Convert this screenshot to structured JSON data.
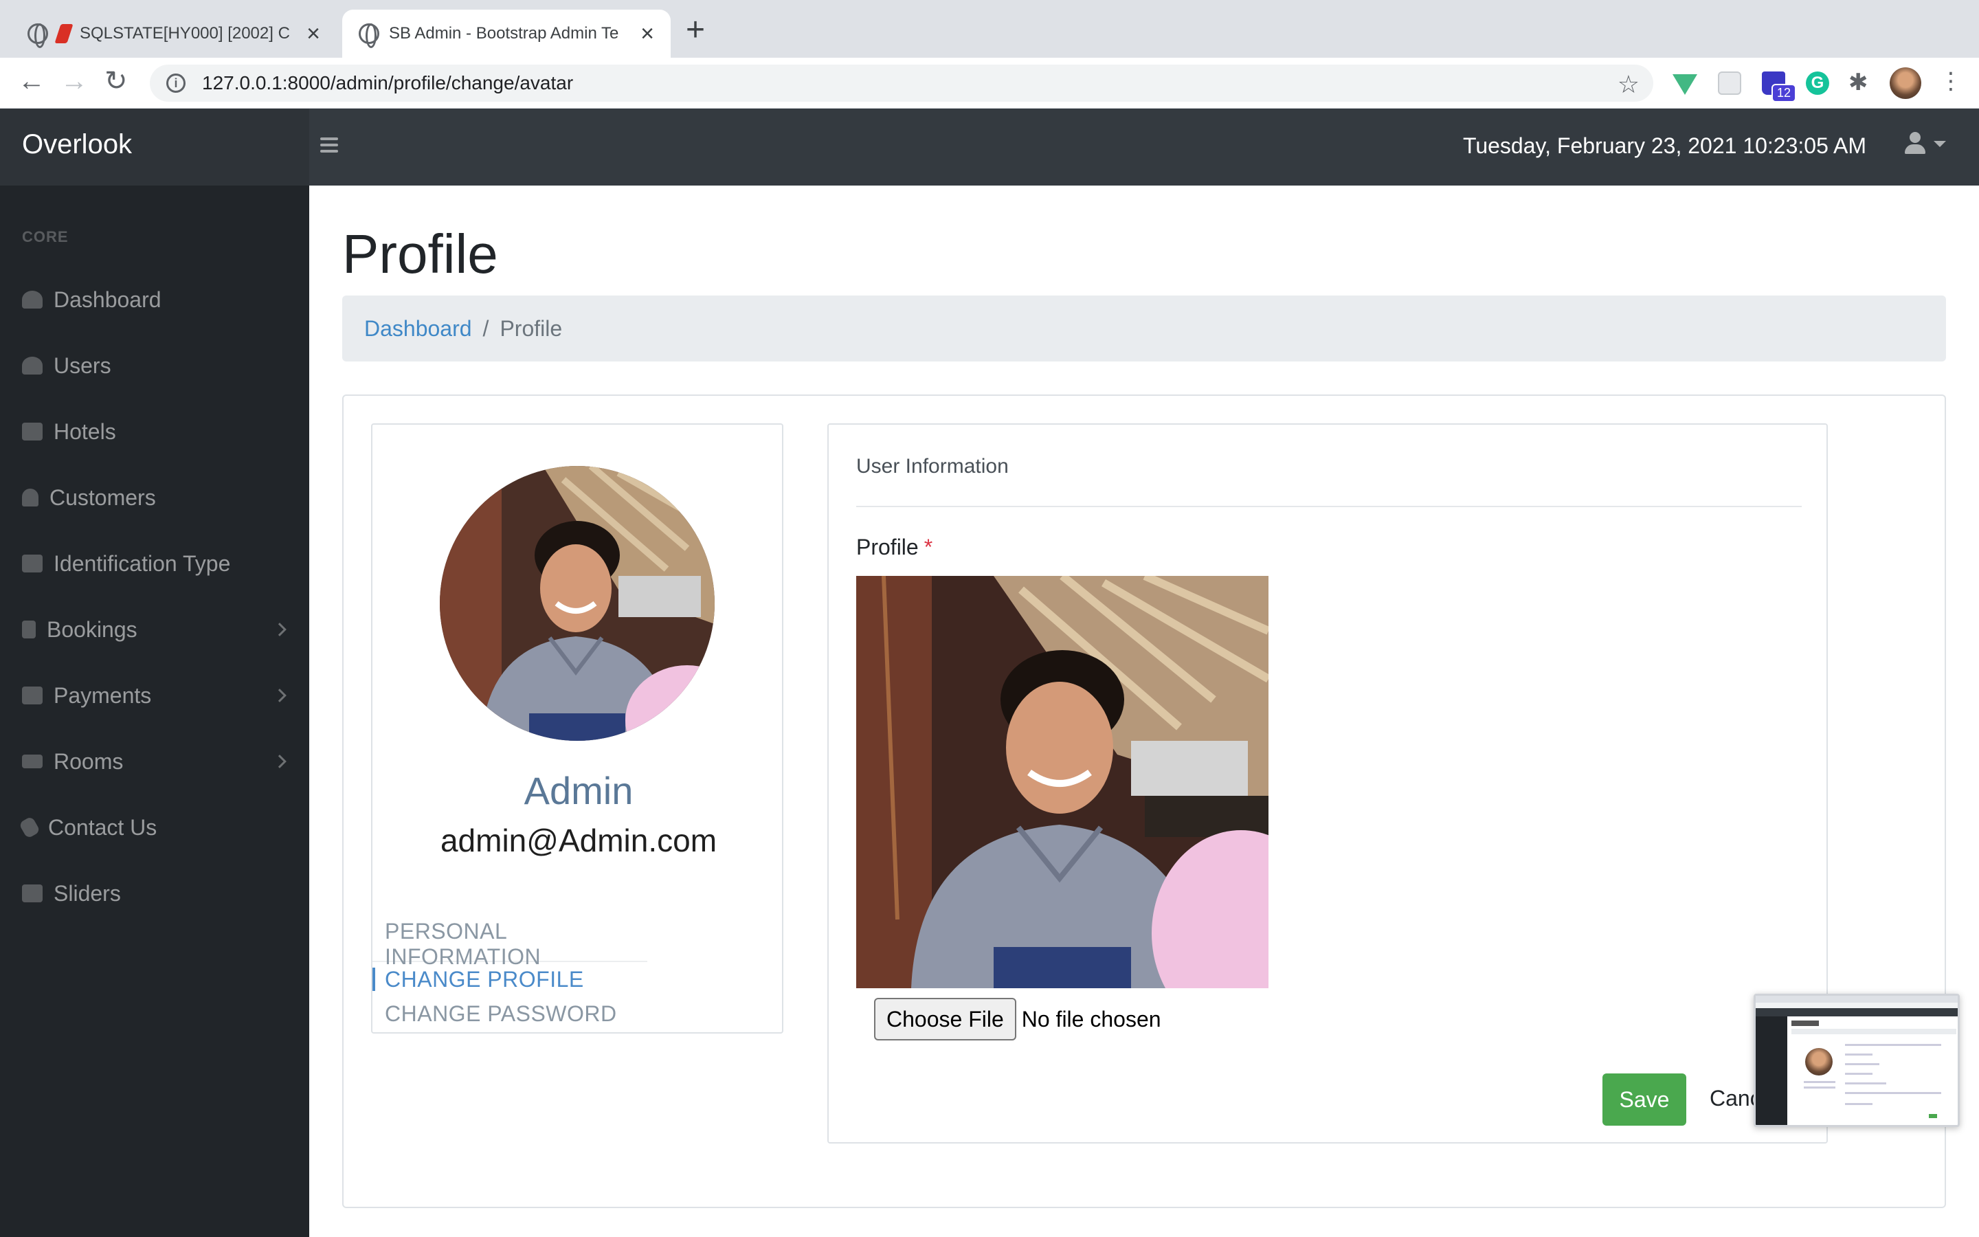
{
  "browser": {
    "tabs": [
      {
        "title": "SQLSTATE[HY000] [2002] C"
      },
      {
        "title": "SB Admin - Bootstrap Admin Te"
      }
    ],
    "url": "127.0.0.1:8000/admin/profile/change/avatar",
    "extension_badge": "12"
  },
  "app": {
    "brand": "Overlook",
    "datetime": "Tuesday, February 23, 2021 10:23:05 AM"
  },
  "sidebar": {
    "heading": "CORE",
    "items": [
      {
        "label": "Dashboard",
        "icon": "gauge-icon"
      },
      {
        "label": "Users",
        "icon": "users-icon"
      },
      {
        "label": "Hotels",
        "icon": "building-icon"
      },
      {
        "label": "Customers",
        "icon": "user-icon"
      },
      {
        "label": "Identification Type",
        "icon": "id-card-icon"
      },
      {
        "label": "Bookings",
        "icon": "bookmark-icon"
      },
      {
        "label": "Payments",
        "icon": "money-icon"
      },
      {
        "label": "Rooms",
        "icon": "bed-icon"
      },
      {
        "label": "Contact Us",
        "icon": "phone-icon"
      },
      {
        "label": "Sliders",
        "icon": "truck-icon"
      }
    ]
  },
  "page": {
    "title": "Profile",
    "breadcrumb": {
      "link": "Dashboard",
      "separator": "/",
      "current": "Profile"
    }
  },
  "profile_card": {
    "name": "Admin",
    "email": "admin@Admin.com",
    "menu": [
      "PERSONAL INFORMATION",
      "CHANGE PROFILE",
      "CHANGE PASSWORD"
    ]
  },
  "form": {
    "section_title": "User Information",
    "field_label": "Profile",
    "required_mark": "*",
    "file_button": "Choose File",
    "file_status": "No file chosen",
    "save_label": "Save",
    "cancel_label": "Cancel"
  },
  "colors": {
    "sidebar_bg": "#212529",
    "topnav_bg": "#343a40",
    "link": "#3f88c7",
    "save": "#4aa84e",
    "required": "#dc3545"
  }
}
